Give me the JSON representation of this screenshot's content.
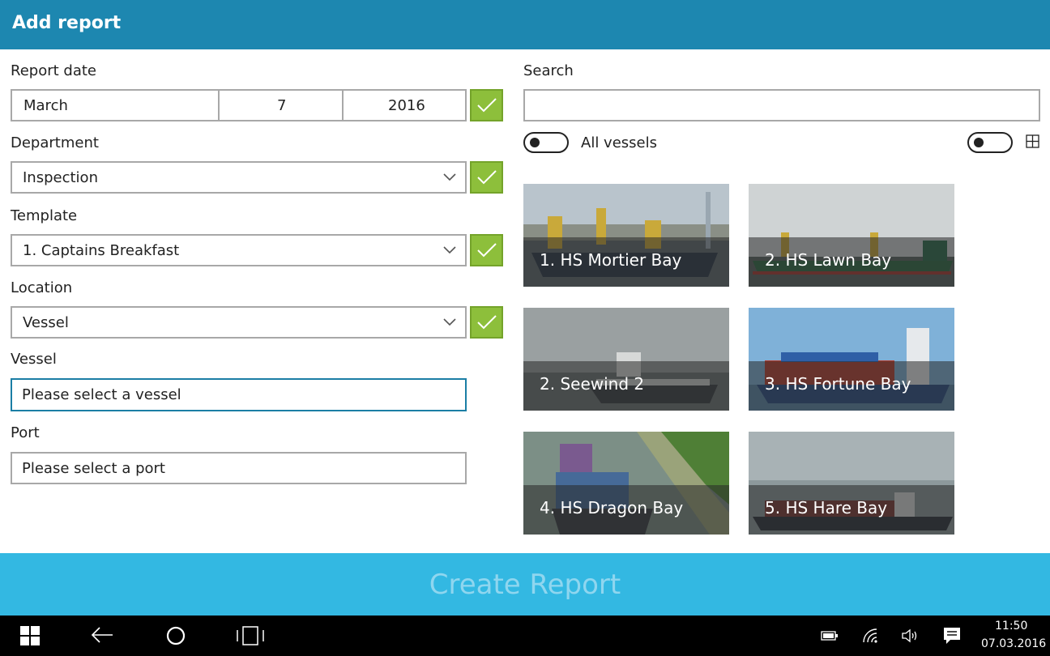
{
  "header": {
    "title": "Add report"
  },
  "form": {
    "report_date_label": "Report date",
    "date_month": "March",
    "date_day": "7",
    "date_year": "2016",
    "department_label": "Department",
    "department_value": "Inspection",
    "template_label": "Template",
    "template_value": "1. Captains Breakfast",
    "location_label": "Location",
    "location_value": "Vessel",
    "vessel_label": "Vessel",
    "vessel_placeholder": "Please select a vessel",
    "port_label": "Port",
    "port_placeholder": "Please select a port"
  },
  "search": {
    "label": "Search",
    "value": "",
    "all_vessels_label": "All vessels"
  },
  "vessels": [
    {
      "label": "1. HS Mortier Bay"
    },
    {
      "label": "2. HS Lawn Bay"
    },
    {
      "label": "2. Seewind 2"
    },
    {
      "label": "3. HS Fortune Bay"
    },
    {
      "label": "4. HS Dragon Bay"
    },
    {
      "label": "5. HS Hare Bay"
    }
  ],
  "actions": {
    "create_label": "Create Report"
  },
  "taskbar": {
    "time": "11:50",
    "date": "07.03.2016"
  },
  "colors": {
    "header": "#1d87b0",
    "accent_check": "#8dbf3b",
    "create_bar": "#33b8e2",
    "focus_border": "#1b7ea5"
  },
  "icons": [
    "check-icon",
    "chevron-down-icon",
    "grid-view-icon",
    "windows-start-icon",
    "back-arrow-icon",
    "search-circle-icon",
    "task-view-icon",
    "battery-icon",
    "wifi-icon",
    "volume-icon",
    "notification-icon"
  ]
}
